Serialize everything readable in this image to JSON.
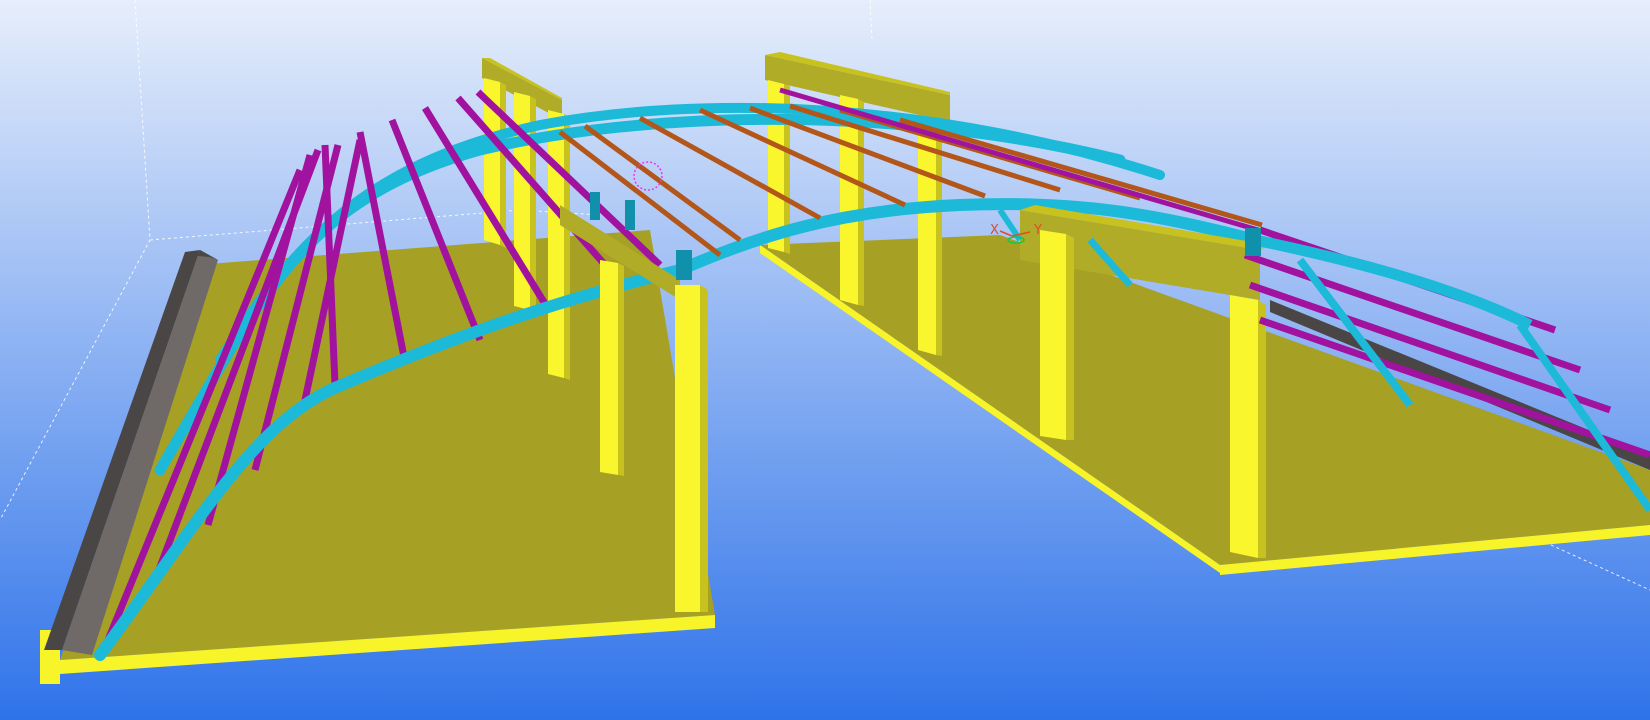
{
  "viewport": {
    "background_top": "#e6eefb",
    "background_bottom": "#2f73ea"
  },
  "model": {
    "colors": {
      "slab_top": "#a6a124",
      "slab_edge": "#f7f429",
      "column_front": "#f9f62e",
      "column_side": "#c7c21e",
      "beam_top": "#b1ac28",
      "arch": "#1db9d8",
      "arch_dark": "#1190ab",
      "purlin_magenta": "#a1129f",
      "purlin_orange": "#b3561a",
      "wall_gray": "#6f6a68",
      "wall_gray_dark": "#4a4645",
      "grid_dotted": "#ffffff"
    }
  },
  "axis_gizmo": {
    "x_label": "X",
    "y_label": "Y",
    "x_color": "#e14a2a",
    "y_color": "#e14a2a",
    "z_color": "#22c33a"
  }
}
